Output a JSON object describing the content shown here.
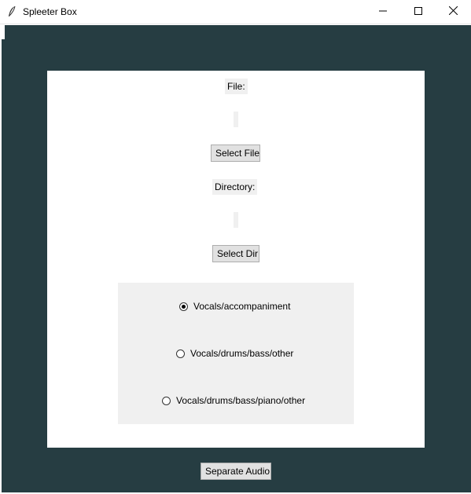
{
  "window": {
    "title": "Spleeter Box",
    "icon": "feather-icon",
    "controls": {
      "minimize": "minimize-icon",
      "maximize": "maximize-icon",
      "close": "close-icon"
    }
  },
  "form": {
    "file_label": "File:",
    "file_value": "",
    "select_file_button": "Select File",
    "directory_label": "Directory:",
    "directory_value": "",
    "select_dir_button": "Select Dir"
  },
  "options": {
    "selected": 0,
    "items": [
      {
        "label": "Vocals/accompaniment"
      },
      {
        "label": "Vocals/drums/bass/other"
      },
      {
        "label": "Vocals/drums/bass/piano/other"
      }
    ]
  },
  "actions": {
    "separate_button": "Separate Audio"
  },
  "colors": {
    "root_background": "#263d42",
    "frame_background": "#ffffff",
    "panel_background": "#f0f0f0"
  }
}
